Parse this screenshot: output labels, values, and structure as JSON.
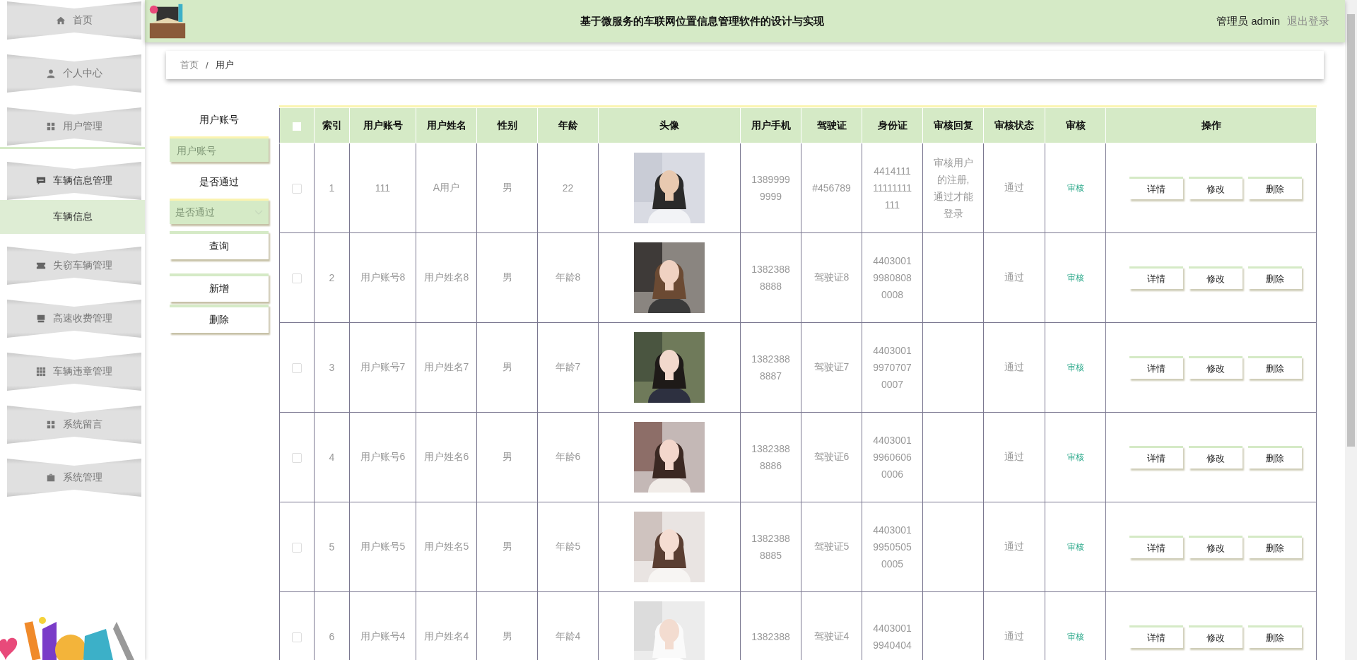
{
  "header": {
    "title": "基于微服务的车联网位置信息管理软件的设计与实现",
    "user": "管理员 admin",
    "logout": "退出登录"
  },
  "sidebar": {
    "items": [
      {
        "label": "首页",
        "expanded": false
      },
      {
        "label": "个人中心",
        "expanded": false
      },
      {
        "label": "用户管理",
        "expanded": false
      },
      {
        "label": "车辆信息管理",
        "expanded": true,
        "children": [
          {
            "label": "车辆信息",
            "selected": true
          }
        ]
      },
      {
        "label": "失窃车辆管理",
        "expanded": false
      },
      {
        "label": "高速收费管理",
        "expanded": false
      },
      {
        "label": "车辆违章管理",
        "expanded": false
      },
      {
        "label": "系统留言",
        "expanded": false
      },
      {
        "label": "系统管理",
        "expanded": false
      }
    ]
  },
  "breadcrumb": {
    "items": [
      "首页",
      "用户"
    ],
    "separator": "/"
  },
  "filters": [
    {
      "kind": "input",
      "label": "用户账号",
      "placeholder": "用户账号"
    },
    {
      "kind": "select",
      "label": "是否通过",
      "placeholder": "是否通过"
    }
  ],
  "filter_buttons": [
    "查询",
    "新增",
    "删除"
  ],
  "table": {
    "select_all": {
      "checked": false
    },
    "columns": [
      "索引",
      "用户账号",
      "用户姓名",
      "性别",
      "年龄",
      "头像",
      "用户手机",
      "驾驶证",
      "身份证",
      "审核回复",
      "审核状态",
      "审核",
      "操作"
    ],
    "rows": [
      {
        "checked": false,
        "index": "1",
        "account": "111",
        "name": "A用户",
        "gender": "男",
        "age": "22",
        "phone": "13899999999",
        "license": "#456789",
        "id_card": "441411111111111111",
        "reply": "审核用户的注册, 通过才能登录",
        "status": "通过",
        "audit": "审核",
        "actions": [
          "详情",
          "修改",
          "删除"
        ]
      },
      {
        "checked": false,
        "index": "2",
        "account": "用户账号8",
        "name": "用户姓名8",
        "gender": "男",
        "age": "年龄8",
        "phone": "13823888888",
        "license": "驾驶证8",
        "id_card": "440300199808080008",
        "status": "通过",
        "audit": "审核",
        "actions": [
          "详情",
          "修改",
          "删除"
        ]
      },
      {
        "checked": false,
        "index": "3",
        "account": "用户账号7",
        "name": "用户姓名7",
        "gender": "男",
        "age": "年龄7",
        "phone": "13823888887",
        "license": "驾驶证7",
        "id_card": "440300199707070007",
        "status": "通过",
        "audit": "审核",
        "actions": [
          "详情",
          "修改",
          "删除"
        ]
      },
      {
        "checked": false,
        "index": "4",
        "account": "用户账号6",
        "name": "用户姓名6",
        "gender": "男",
        "age": "年龄6",
        "phone": "13823888886",
        "license": "驾驶证6",
        "id_card": "440300199606060006",
        "status": "通过",
        "audit": "审核",
        "actions": [
          "详情",
          "修改",
          "删除"
        ]
      },
      {
        "checked": false,
        "index": "5",
        "account": "用户账号5",
        "name": "用户姓名5",
        "gender": "男",
        "age": "年龄5",
        "phone": "13823888885",
        "license": "驾驶证5",
        "id_card": "440300199505050005",
        "status": "通过",
        "audit": "审核",
        "actions": [
          "详情",
          "修改",
          "删除"
        ]
      },
      {
        "checked": false,
        "index": "6",
        "account": "用户账号4",
        "name": "用户姓名4",
        "gender": "男",
        "age": "年龄4",
        "phone": "1382388",
        "license": "驾驶证4",
        "id_card": "44030019940404",
        "status": "通过",
        "audit": "审核",
        "actions": [
          "详情",
          "修改",
          "删除"
        ]
      }
    ]
  }
}
